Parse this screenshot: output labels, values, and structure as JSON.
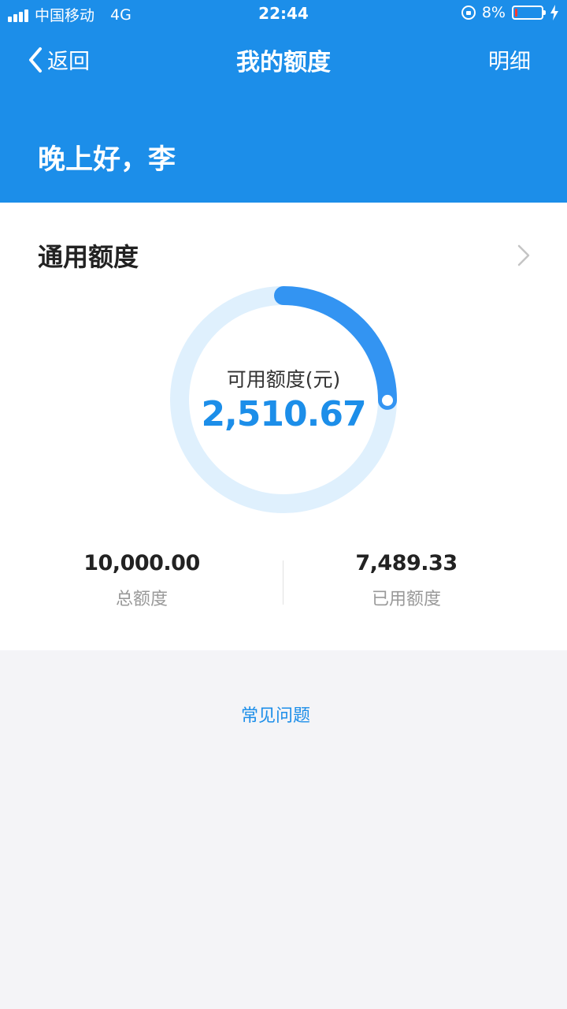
{
  "status_bar": {
    "carrier": "中国移动",
    "network": "4G",
    "time": "22:44",
    "battery_percent": "8%",
    "battery_level": 0.08,
    "battery_color": "#ff3b30"
  },
  "nav": {
    "back_label": "返回",
    "title": "我的额度",
    "detail_label": "明细"
  },
  "greeting": "晚上好，李",
  "card": {
    "title": "通用额度",
    "ring_label": "可用额度(元)",
    "available": "2,510.67",
    "available_fraction": 0.2511,
    "total_value": "10,000.00",
    "total_label": "总额度",
    "used_value": "7,489.33",
    "used_label": "已用额度"
  },
  "faq_label": "常见问题",
  "colors": {
    "primary": "#1c8ee9",
    "ring_progress": "#3394f2",
    "ring_track": "#dff0fd",
    "page_background": "#f4f4f7"
  },
  "icons": {
    "back": "chevron-left-icon",
    "card_arrow": "chevron-right-icon",
    "rotation_lock": "rotation-lock-icon",
    "battery": "battery-icon",
    "charging": "lightning-bolt-icon",
    "signal": "signal-bars-icon"
  }
}
